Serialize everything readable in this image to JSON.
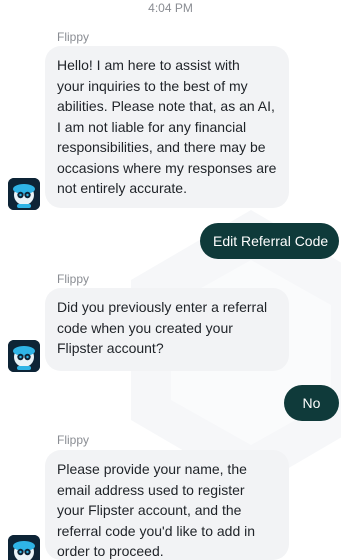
{
  "chat": {
    "timestamp": "4:04 PM",
    "bot_name": "Flippy",
    "messages": [
      {
        "from": "bot",
        "sender": "Flippy",
        "text": "Hello! I am here to assist with\nyour inquiries to the best of my\nabilities. Please note that, as an AI,\nI am not liable for any financial\nresponsibilities, and there may be\noccasions where my responses are\nnot entirely accurate."
      },
      {
        "from": "user",
        "text": "Edit Referral Code"
      },
      {
        "from": "bot",
        "sender": "Flippy",
        "text": "Did you previously enter a referral\ncode when you created your\nFlipster account?"
      },
      {
        "from": "user",
        "text": "No"
      },
      {
        "from": "bot",
        "sender": "Flippy",
        "text": "Please provide your name, the\nemail address used to register\nyour Flipster account, and the\nreferral code you'd like to add in\norder to proceed."
      }
    ]
  },
  "colors": {
    "bot_bubble": "#f2f3f5",
    "user_bubble": "#0f3a3a",
    "meta_text": "#8a8d93"
  },
  "icons": {
    "avatar": "flippy-robot-avatar-icon"
  }
}
